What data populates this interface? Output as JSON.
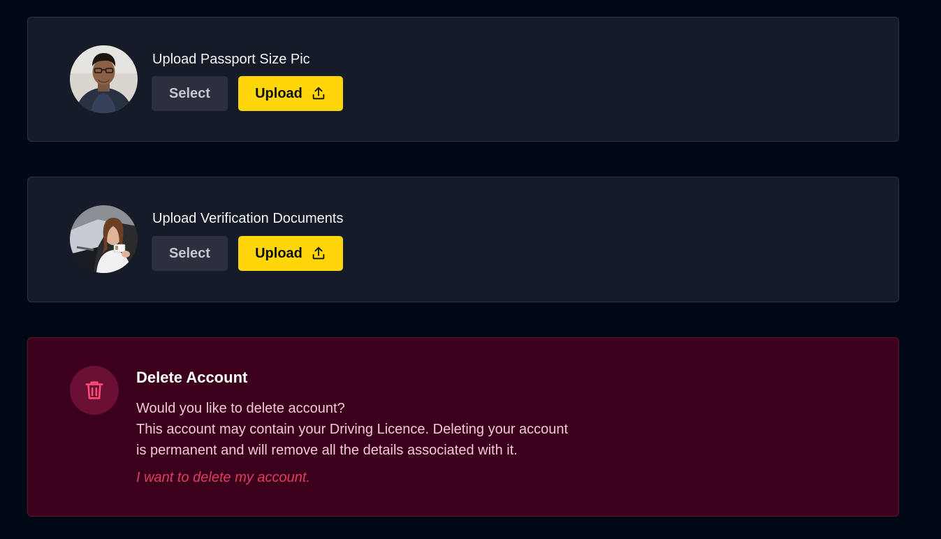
{
  "passport_card": {
    "title": "Upload Passport Size Pic",
    "select_label": "Select",
    "upload_label": "Upload",
    "upload_icon": "upload-icon",
    "avatar": "passport-photo-avatar"
  },
  "documents_card": {
    "title": "Upload Verification Documents",
    "select_label": "Select",
    "upload_label": "Upload",
    "upload_icon": "upload-icon",
    "avatar": "verification-document-avatar"
  },
  "delete_card": {
    "icon": "trash-icon",
    "title": "Delete Account",
    "lines": [
      "Would you like to delete account?",
      "This account may contain your Driving Licence. Deleting your account",
      "is permanent and will remove all the details associated with it."
    ],
    "action_label": "I want to delete my account."
  },
  "colors": {
    "page_background": "#000814",
    "card_background": "#161b28",
    "danger_background": "#3b001b",
    "accent_yellow": "#ffd60a",
    "danger_accent": "#e23c64"
  }
}
